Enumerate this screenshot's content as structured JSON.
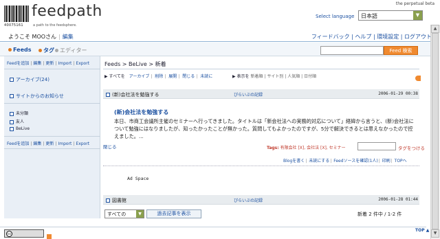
{
  "header": {
    "logo_word": "feedpath",
    "logo_barcode_number": "40075161",
    "logo_tagline": "a path to the feedsphere.",
    "beta": "the perpetual beta",
    "language_label": "Select language",
    "language_value": "日本語"
  },
  "user": {
    "welcome": "ようこそ MOOさん",
    "edit": "編集"
  },
  "top_links": {
    "feedback": "フィードバック",
    "help": "ヘルプ",
    "settings": "環境設定",
    "logout": "ログアウト"
  },
  "tabs": {
    "feeds": "Feeds",
    "tags": "タグ",
    "editor": "エディター"
  },
  "search": {
    "placeholder": "",
    "button": "Feed 検索"
  },
  "sidebar": {
    "actions": [
      "Feedを追加",
      "編集",
      "更新",
      "Import",
      "Export"
    ],
    "items": [
      {
        "label": "アーカイブ(24)"
      },
      {
        "label": "サイトからのお知らせ"
      }
    ],
    "subitems": [
      "未分類",
      "友人",
      "BeLive"
    ]
  },
  "breadcrumb": "Feeds > BeLive > 新着",
  "filters": {
    "items": [
      "すべてを",
      "アーカイブ",
      "削除",
      "展開",
      "閉じる",
      "未読に"
    ],
    "display_label": "表示を",
    "display_items": [
      "新着順",
      "サイト別",
      "人気順",
      "日付順"
    ]
  },
  "entries": [
    {
      "title": "(新)会社法を勉強する",
      "source": "ぴらいぶの記録",
      "date": "2006-01-29 00:38"
    },
    {
      "title": "図書館",
      "source": "ぴらいぶの記録",
      "date": "2006-01-28 01:44"
    }
  ],
  "entry_detail": {
    "title": "(新)会社法を勉強する",
    "body": "本日、市商工会議所主催のセミナーへ行ってきました。タイトルは「新会社法への実務的対応について」経緯から言うと、(新)会社法について勉強にはなりましたが、知ったかったことが無かった。質問してもよかったのですが、5分で解決できるとは思えなかったので控えました。...",
    "close": "閉じる",
    "tags_label": "Tags:",
    "tags": [
      "有限会社 [X]",
      "会社法 [X]",
      "セミナー"
    ],
    "tag_button": "タグをつける",
    "actions": [
      "Blogを書く",
      "未読にする",
      "Feedソースを確認(1人)",
      "印刷",
      "TOPへ"
    ],
    "ad": "Ad Space"
  },
  "bottom": {
    "per_page": "すべての",
    "past_button": "過去記事を表示",
    "pager": "新着 2 件中 / 1-2 件",
    "top": "TOP"
  },
  "colors": {
    "accent_orange": "#f08a30",
    "link_blue": "#1a4fa0",
    "sidebar_bg": "#e9eff6"
  }
}
